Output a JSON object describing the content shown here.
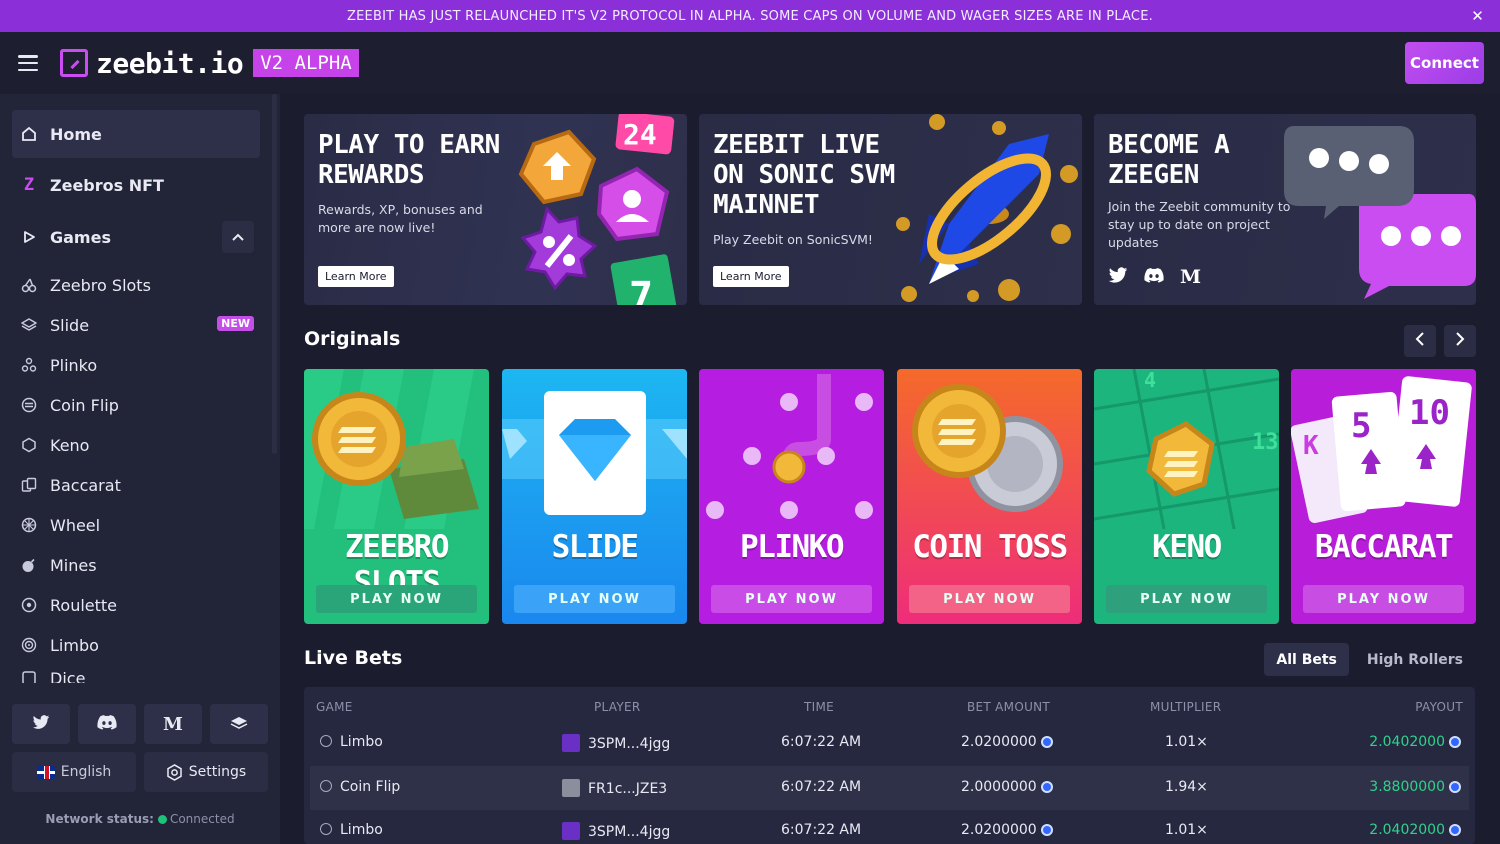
{
  "announcement": {
    "text": "ZEEBIT HAS JUST RELAUNCHED IT'S V2 PROTOCOL IN ALPHA. SOME CAPS ON VOLUME AND WAGER SIZES ARE IN PLACE.",
    "close": "✕"
  },
  "header": {
    "logo_text": "zeebit.io",
    "version_badge": "V2 ALPHA",
    "connect_label": "Connect"
  },
  "sidebar": {
    "home": "Home",
    "nft": "Zeebros NFT",
    "games": "Games",
    "items": [
      {
        "label": "Zeebro Slots",
        "icon": "cherry-icon"
      },
      {
        "label": "Slide",
        "icon": "layers-icon",
        "badge": "NEW"
      },
      {
        "label": "Plinko",
        "icon": "plinko-icon"
      },
      {
        "label": "Coin Flip",
        "icon": "coin-icon"
      },
      {
        "label": "Keno",
        "icon": "hexagon-icon"
      },
      {
        "label": "Baccarat",
        "icon": "cards-icon"
      },
      {
        "label": "Wheel",
        "icon": "wheel-icon"
      },
      {
        "label": "Mines",
        "icon": "bomb-icon"
      },
      {
        "label": "Roulette",
        "icon": "roulette-icon"
      },
      {
        "label": "Limbo",
        "icon": "target-icon"
      },
      {
        "label": "Dice",
        "icon": "dice-icon"
      }
    ],
    "social": [
      "twitter-icon",
      "discord-icon",
      "medium-icon",
      "docs-icon"
    ],
    "medium_glyph": "M",
    "language": "English",
    "settings": "Settings",
    "network_label": "Network status:",
    "network_value": "Connected"
  },
  "banners": [
    {
      "title1": "PLAY TO EARN",
      "title2": "REWARDS",
      "desc": "Rewards, XP, bonuses and more are now live!",
      "cta": "Learn More"
    },
    {
      "title1": "ZEEBIT LIVE",
      "title2": "ON SONIC SVM",
      "title3": "MAINNET",
      "desc": "Play Zeebit on SonicSVM!",
      "cta": "Learn More"
    },
    {
      "title1": "BECOME A",
      "title2": "ZEEGEN",
      "desc": "Join the Zeebit community to stay up to date on project updates",
      "medium": "M"
    }
  ],
  "originals": {
    "title": "Originals",
    "games": [
      {
        "name": "ZEEBRO SLOTS",
        "cta": "PLAY NOW",
        "bg": "#22c07c",
        "btn": "#2aa57a"
      },
      {
        "name": "SLIDE",
        "cta": "PLAY NOW",
        "bg": "#1d8ff0",
        "btn": "#3aa3f7"
      },
      {
        "name": "PLINKO",
        "cta": "PLAY NOW",
        "bg": "#b51ee0",
        "btn": "#c94ce7"
      },
      {
        "name": "COIN TOSS",
        "cta": "PLAY NOW",
        "bg": "#f03c6a",
        "btn": "#f26387"
      },
      {
        "name": "KENO",
        "cta": "PLAY NOW",
        "bg": "#1bb57d",
        "btn": "#2ea07c"
      },
      {
        "name": "BACCARAT",
        "cta": "PLAY NOW",
        "bg": "#b81dd9",
        "btn": "#c84ee3"
      }
    ]
  },
  "live_bets": {
    "title": "Live Bets",
    "tabs": [
      "All Bets",
      "High Rollers"
    ],
    "columns": [
      "GAME",
      "PLAYER",
      "TIME",
      "BET AMOUNT",
      "MULTIPLIER",
      "PAYOUT"
    ],
    "rows": [
      {
        "game": "Limbo",
        "player": "3SPM...4jgg",
        "time": "6:07:22 AM",
        "bet": "2.0200000",
        "mult": "1.01×",
        "payout": "2.0402000"
      },
      {
        "game": "Coin Flip",
        "player": "FR1c...JZE3",
        "time": "6:07:22 AM",
        "bet": "2.0000000",
        "mult": "1.94×",
        "payout": "3.8800000"
      },
      {
        "game": "Limbo",
        "player": "3SPM...4jgg",
        "time": "6:07:22 AM",
        "bet": "2.0200000",
        "mult": "1.01×",
        "payout": "2.0402000"
      }
    ]
  }
}
